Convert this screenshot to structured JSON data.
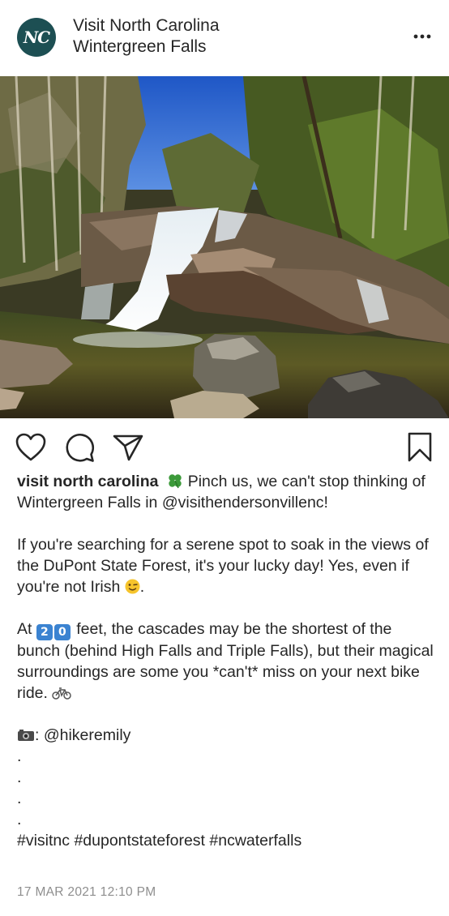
{
  "post": {
    "account_name": "Visit North Carolina",
    "location": "Wintergreen Falls",
    "avatar_text": "NC",
    "more_icon": "ellipsis-icon",
    "photo_description_icon": "waterfall-photo"
  },
  "actions": {
    "like_icon": "heart-icon",
    "comment_icon": "comment-icon",
    "share_icon": "paper-plane-icon",
    "save_icon": "bookmark-icon"
  },
  "caption": {
    "username": "visit north carolina",
    "line1_rest": " Pinch us, we can't stop thinking of Wintergreen Falls in @visithendersonvillenc!",
    "para2": "If you're searching for a serene spot to soak in the views of the DuPont State Forest, it's your lucky day! Yes, even if you're not Irish",
    "para2_end": ".",
    "para3_start": "At ",
    "keycap_2": "2",
    "keycap_0": "0",
    "para3_rest": " feet, the cascades may be the shortest of the bunch (behind High Falls and Triple Falls), but their magical surroundings are some you *can't* miss on your next bike ride. ",
    "credit": ": @hikeremily",
    "dot": ".",
    "hashtags": "#visitnc #dupontstateforest #ncwaterfalls"
  },
  "timestamp": "17 MAR 2021 12:10 PM",
  "colors": {
    "avatar_bg": "#1d4f53",
    "text": "#262626",
    "muted": "#8e8e8e",
    "clover": "#3c9a3a",
    "keycap": "#3b83d1"
  }
}
